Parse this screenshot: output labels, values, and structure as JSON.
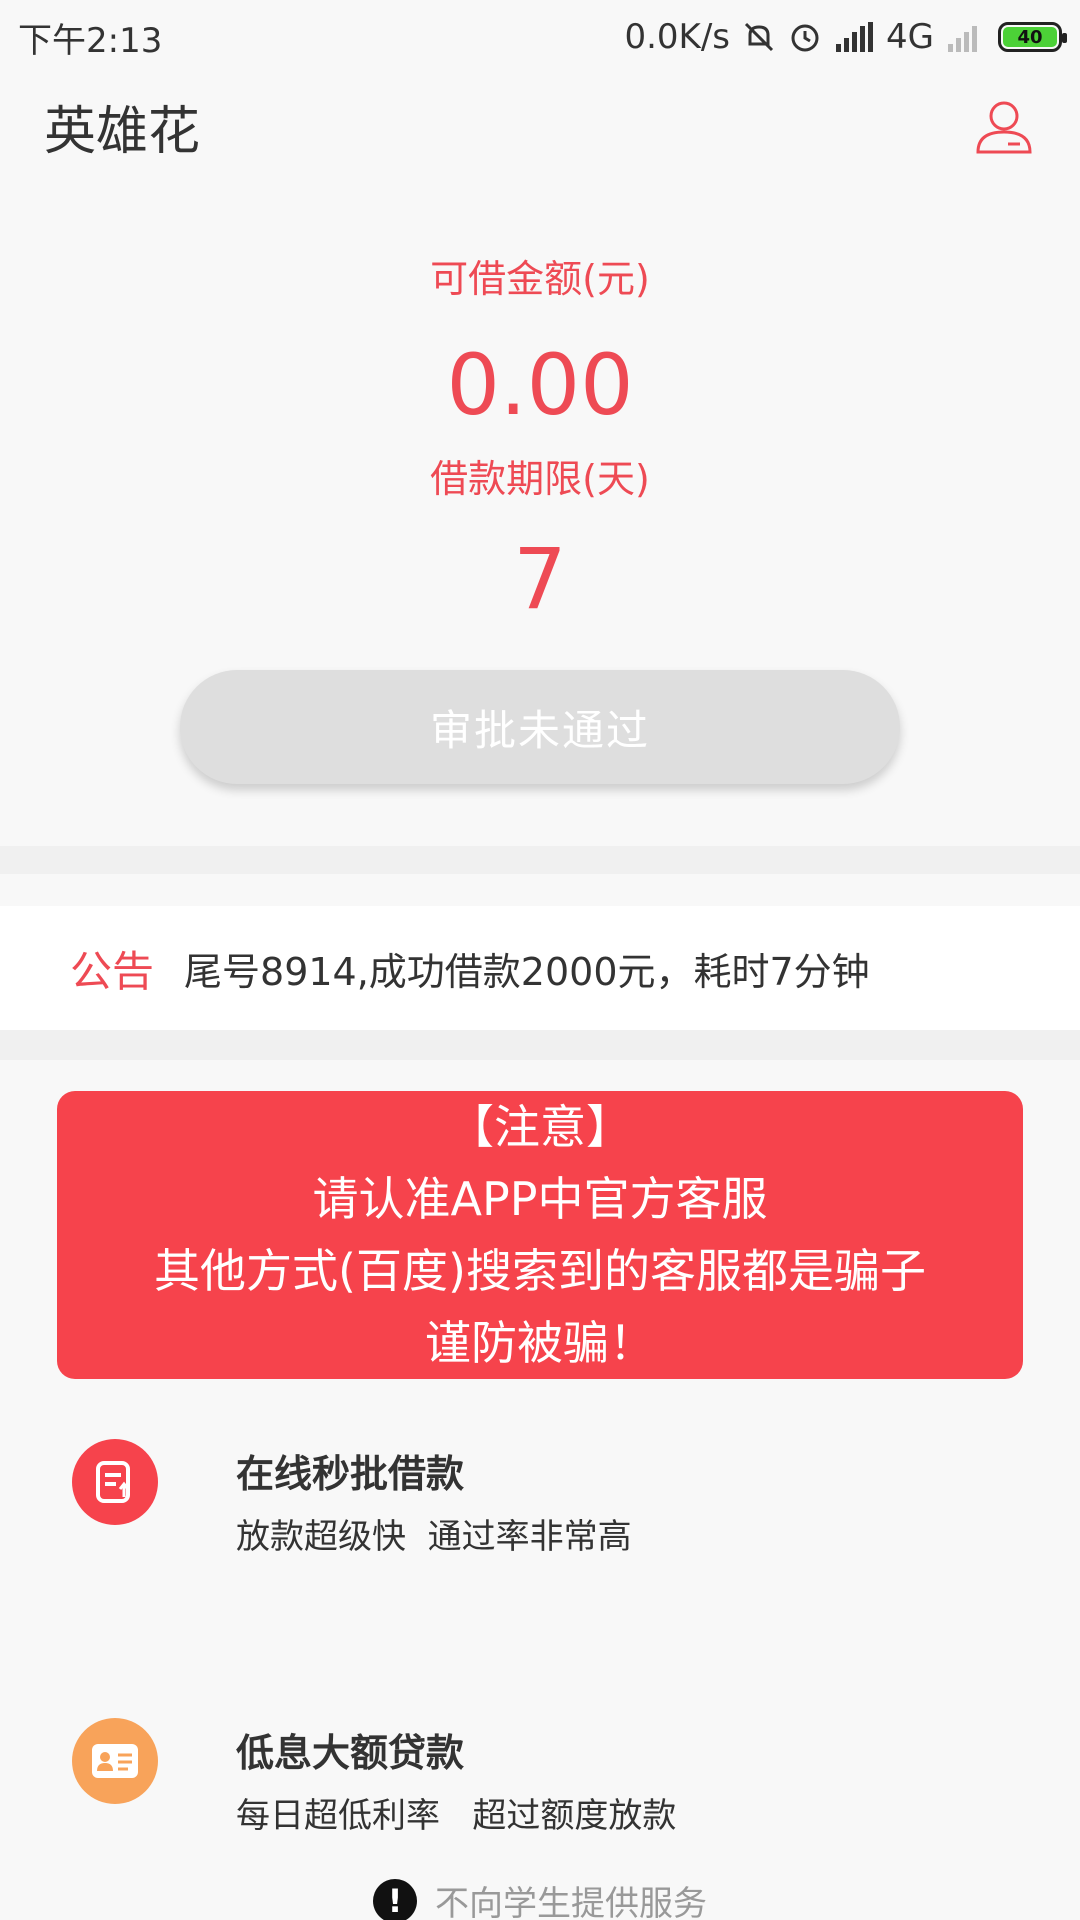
{
  "status_bar": {
    "time": "下午2:13",
    "network_speed": "0.0K/s",
    "network_type": "4G",
    "battery": "40",
    "icons": [
      "mute-icon",
      "alarm-icon",
      "signal-icon",
      "signal-weak-icon"
    ]
  },
  "header": {
    "title": "英雄花",
    "profile_icon": "user-icon"
  },
  "hero": {
    "amount_label": "可借金额(元)",
    "amount_value": "0.00",
    "term_label": "借款期限(天)",
    "term_value": "7",
    "button_label": "审批未通过"
  },
  "notice": {
    "label": "公告",
    "text": "尾号8914,成功借款2000元，耗时7分钟"
  },
  "warning": {
    "lines": [
      "【注意】",
      "请认准APP中官方客服",
      "其他方式(百度)搜索到的客服都是骗子",
      "谨防被骗！"
    ]
  },
  "features": [
    {
      "title": "在线秒批借款",
      "subtitle": "放款超级快  通过率非常高",
      "icon": "document-icon",
      "color": "#f6434c"
    },
    {
      "title": "低息大额贷款",
      "subtitle": "每日超低利率   超过额度放款",
      "icon": "id-card-icon",
      "color": "#f8a35a"
    }
  ],
  "footer": {
    "text": "不向学生提供服务",
    "icon": "alert-icon"
  },
  "colors": {
    "accent": "#ee4a54",
    "warning_bg": "#f6434c",
    "orange": "#f8a35a"
  }
}
